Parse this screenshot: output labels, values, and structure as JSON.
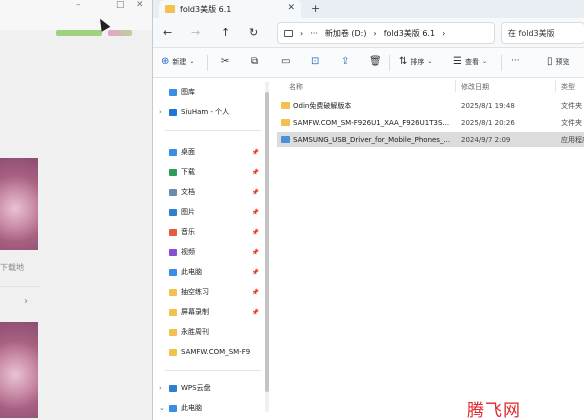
{
  "background_app": {
    "window_controls": [
      "–",
      "□",
      "✕"
    ],
    "download_text": "下载地",
    "chevron": "›"
  },
  "explorer": {
    "tab_title": "fold3美版 6.1",
    "tab_close": "✕",
    "new_tab": "+",
    "nav": {
      "back": "←",
      "forward": "→",
      "up": "↑",
      "refresh": "↻"
    },
    "address": {
      "more": "···",
      "sep": "›",
      "path": [
        "新加卷 (D:)",
        "fold3美版 6.1"
      ]
    },
    "search_placeholder": "在 fold3美版",
    "commands": {
      "new": "新建",
      "sort": "排序",
      "view": "查看",
      "more": "···",
      "preview": "预览"
    },
    "nav_pane": {
      "items": [
        {
          "label": "图库",
          "chev": "",
          "color": "#3a8ee6",
          "pinned": false
        },
        {
          "label": "SiuHam - 个人",
          "chev": "›",
          "color": "#1f75d6",
          "pinned": false
        },
        {
          "label": "桌面",
          "chev": "",
          "color": "#3a8ee6",
          "pinned": true
        },
        {
          "label": "下载",
          "chev": "",
          "color": "#2f9b58",
          "pinned": true
        },
        {
          "label": "文档",
          "chev": "",
          "color": "#6b8cae",
          "pinned": true
        },
        {
          "label": "图片",
          "chev": "",
          "color": "#2f7fd0",
          "pinned": true
        },
        {
          "label": "音乐",
          "chev": "",
          "color": "#e55a3b",
          "pinned": true
        },
        {
          "label": "视频",
          "chev": "",
          "color": "#8a4fd0",
          "pinned": true
        },
        {
          "label": "此电脑",
          "chev": "",
          "color": "#3a8ee6",
          "pinned": true
        },
        {
          "label": "抽空练习",
          "chev": "",
          "color": "#f3c24e",
          "pinned": true
        },
        {
          "label": "屏幕录制",
          "chev": "",
          "color": "#f3c24e",
          "pinned": true
        },
        {
          "label": "永胜周刊",
          "chev": "",
          "color": "#f3c24e",
          "pinned": false
        },
        {
          "label": "SAMFW.COM_SM-F9",
          "chev": "",
          "color": "#f3c24e",
          "pinned": false
        },
        {
          "label": "WPS云盘",
          "chev": "›",
          "color": "#2f7fd0",
          "pinned": false
        },
        {
          "label": "此电脑",
          "chev": "⌄",
          "color": "#3a8ee6",
          "pinned": false
        }
      ],
      "pin_glyph": "📌"
    },
    "columns": {
      "name": "名称",
      "date": "修改日期",
      "type": "类型"
    },
    "files": [
      {
        "name": "Odin免费破解版本",
        "date": "2025/8/1 19:48",
        "type": "文件夹",
        "color": "#f3c24e",
        "selected": false
      },
      {
        "name": "SAMFW.COM_SM-F926U1_XAA_F926U1T3S...",
        "date": "2025/8/1 20:26",
        "type": "文件夹",
        "color": "#f3c24e",
        "selected": false
      },
      {
        "name": "SAMSUNG_USB_Driver_for_Mobile_Phones_...",
        "date": "2024/9/7 2:09",
        "type": "应用程序",
        "color": "#4a8fdb",
        "selected": true
      }
    ],
    "watermark": "腾飞网"
  }
}
